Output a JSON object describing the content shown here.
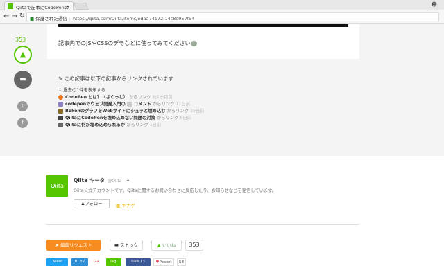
{
  "browser": {
    "tab_title": "Qiitaで記事にCodePenの",
    "tab_close": "×",
    "secure_label": "保護された通信",
    "url": "https://qiita.com/Qiita/items/edaa74172:14c8e957f54"
  },
  "article": {
    "lead": "記事内でのJSやCSSのデモなどに使ってみてください"
  },
  "sidebar": {
    "like_count": "353"
  },
  "links": {
    "heading": "この記事は以下の記事からリンクされています",
    "show_past": "過去の1件を表示する",
    "items": [
      {
        "title": "CodePen とは？（さくっと）",
        "suffix": "からリンク",
        "time": "約1ヶ月前",
        "color": "#e8741e"
      },
      {
        "title": "codepenでウェブ開発入門の",
        "extra": "コメント",
        "suffix": "からリンク",
        "time": "11日前",
        "color": "#8a7fc0"
      },
      {
        "title": "BokehのグラフをWebサイトにシュッと埋め込む",
        "suffix": "からリンク",
        "time": "19日前",
        "color": "#8a6a2a"
      },
      {
        "title": "QiitaにCodePenを埋め込めない問題の対策",
        "suffix": "からリンク",
        "time": "6日前",
        "color": "#444"
      },
      {
        "title": "Qiitaに何が埋め込められるか",
        "suffix": "からリンク",
        "time": "1日前",
        "color": "#666"
      }
    ]
  },
  "author": {
    "logo": "Qiita",
    "name": "Qiita キータ",
    "handle": "@Qiita",
    "desc": "Qiita公式アカウントです。Qiitaに関するお問い合わせに反応したり、お知らせなどを発信しています。",
    "follow": "フォロー",
    "sponsor": "キナゲ"
  },
  "actions": {
    "request": "編集リクエスト",
    "stock": "ストック",
    "like": "いいね",
    "like_count": "353"
  },
  "share": {
    "tweet": "Tweet",
    "hatena": "B! 57",
    "gplus": "G+",
    "tagg": "Tag!",
    "fb": "Like 13",
    "pocket": "Pocket",
    "pocket_count": "58"
  }
}
